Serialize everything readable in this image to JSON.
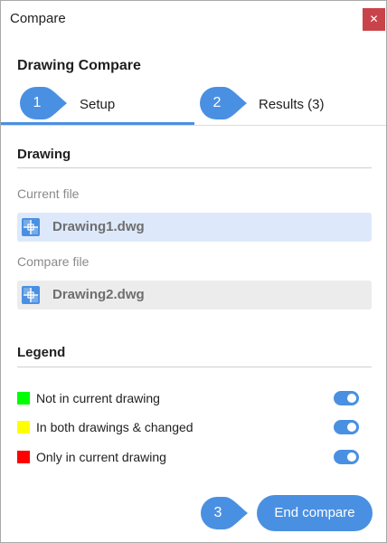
{
  "window": {
    "title": "Compare",
    "close_glyph": "✕"
  },
  "header": {
    "title": "Drawing Compare"
  },
  "tabs": [
    {
      "step": "1",
      "label": "Setup",
      "active": true
    },
    {
      "step": "2",
      "label": "Results (3)",
      "active": false
    }
  ],
  "drawing": {
    "section_title": "Drawing",
    "current_file_label": "Current file",
    "current_file_name": "Drawing1.dwg",
    "compare_file_label": "Compare file",
    "compare_file_name": "Drawing2.dwg",
    "file_icon": "drawing-file-icon"
  },
  "legend": {
    "section_title": "Legend",
    "items": [
      {
        "label": "Not in current drawing",
        "color": "#00ff00",
        "enabled": true
      },
      {
        "label": "In both drawings & changed",
        "color": "#ffff00",
        "enabled": true
      },
      {
        "label": "Only in current drawing",
        "color": "#ff0000",
        "enabled": true
      }
    ]
  },
  "footer": {
    "step": "3",
    "button_label": "End compare"
  },
  "colors": {
    "accent": "#4a90e2",
    "close": "#c9434a",
    "current_file_bg": "#dde9fb",
    "compare_file_bg": "#ececec"
  }
}
